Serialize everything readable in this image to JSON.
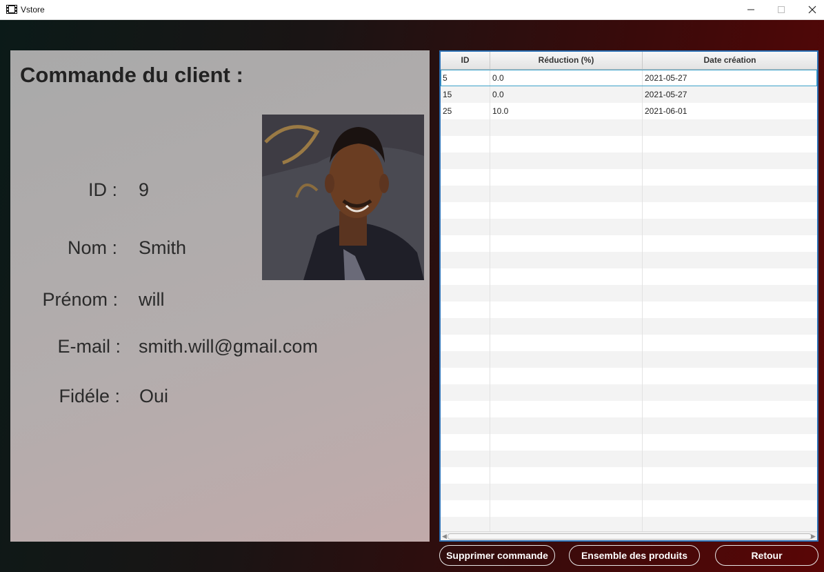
{
  "window": {
    "title": "Vstore",
    "app_icon": "film-strip-icon",
    "minimize_icon": "minimize-icon",
    "maximize_icon": "maximize-icon",
    "close_icon": "close-icon"
  },
  "info": {
    "title": "Commande du client :",
    "photo": "client-photo",
    "fields": [
      {
        "label": "ID :",
        "value": "9"
      },
      {
        "label": "Nom :",
        "value": "Smith"
      },
      {
        "label": "Prénom :",
        "value": "will"
      },
      {
        "label": "E-mail :",
        "value": "smith.will@gmail.com"
      },
      {
        "label": "Fidéle :",
        "value": "Oui"
      }
    ]
  },
  "table": {
    "columns": [
      "ID",
      "Réduction (%)",
      "Date création"
    ],
    "rows": [
      [
        "5",
        "0.0",
        "2021-05-27"
      ],
      [
        "15",
        "0.0",
        "2021-05-27"
      ],
      [
        "25",
        "10.0",
        "2021-06-01"
      ]
    ],
    "selected_row": 0,
    "border_color": "#2a6fb4"
  },
  "buttons": {
    "delete_order": "Supprimer commande",
    "all_products": "Ensemble des produits",
    "back": "Retour"
  }
}
